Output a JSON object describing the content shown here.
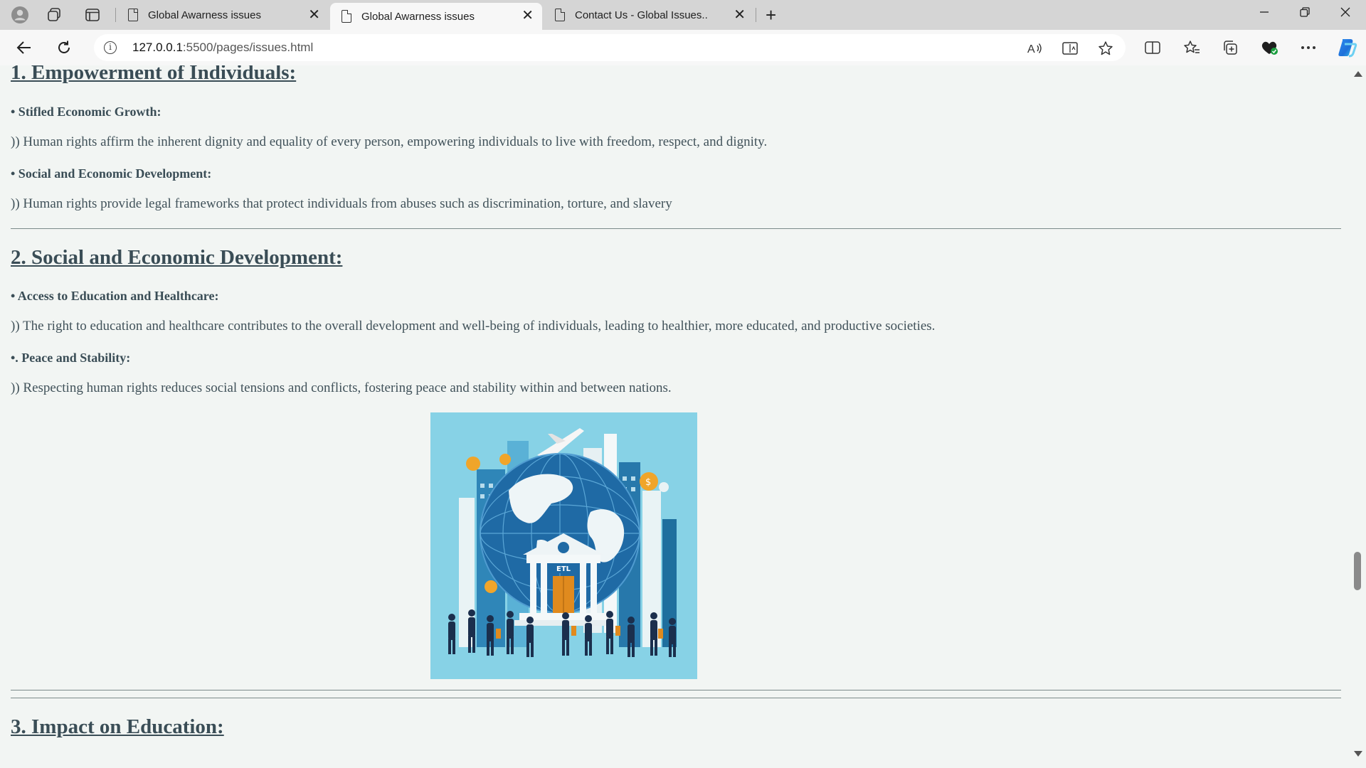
{
  "browser": {
    "tabs": [
      {
        "title": "Global Awarness issues",
        "active": false
      },
      {
        "title": "Global Awarness issues",
        "active": true
      },
      {
        "title": "Contact Us - Global Issues..",
        "active": false
      }
    ],
    "address": {
      "host": "127.0.0.1",
      "path": ":5500/pages/issues.html"
    },
    "accent_color": "#1a73e8"
  },
  "page": {
    "sections": [
      {
        "heading": "1. Empowerment of Individuals:",
        "items": [
          {
            "subhead": "• Stifled Economic Growth:",
            "text": ")) Human rights affirm the inherent dignity and equality of every person, empowering individuals to live with freedom, respect, and dignity."
          },
          {
            "subhead": "• Social and Economic Development:",
            "text": ")) Human rights provide legal frameworks that protect individuals from abuses such as discrimination, torture, and slavery"
          }
        ]
      },
      {
        "heading": "2. Social and Economic Development:",
        "items": [
          {
            "subhead": "• Access to Education and Healthcare:",
            "text": ")) The right to education and healthcare contributes to the overall development and well-being of individuals, leading to healthier, more educated, and productive societies."
          },
          {
            "subhead": "•. Peace and Stability:",
            "text": ")) Respecting human rights reduces social tensions and conflicts, fostering peace and stability within and between nations."
          }
        ],
        "image": {
          "building_sign": "ETL"
        }
      },
      {
        "heading": "3. Impact on Education:"
      }
    ]
  }
}
